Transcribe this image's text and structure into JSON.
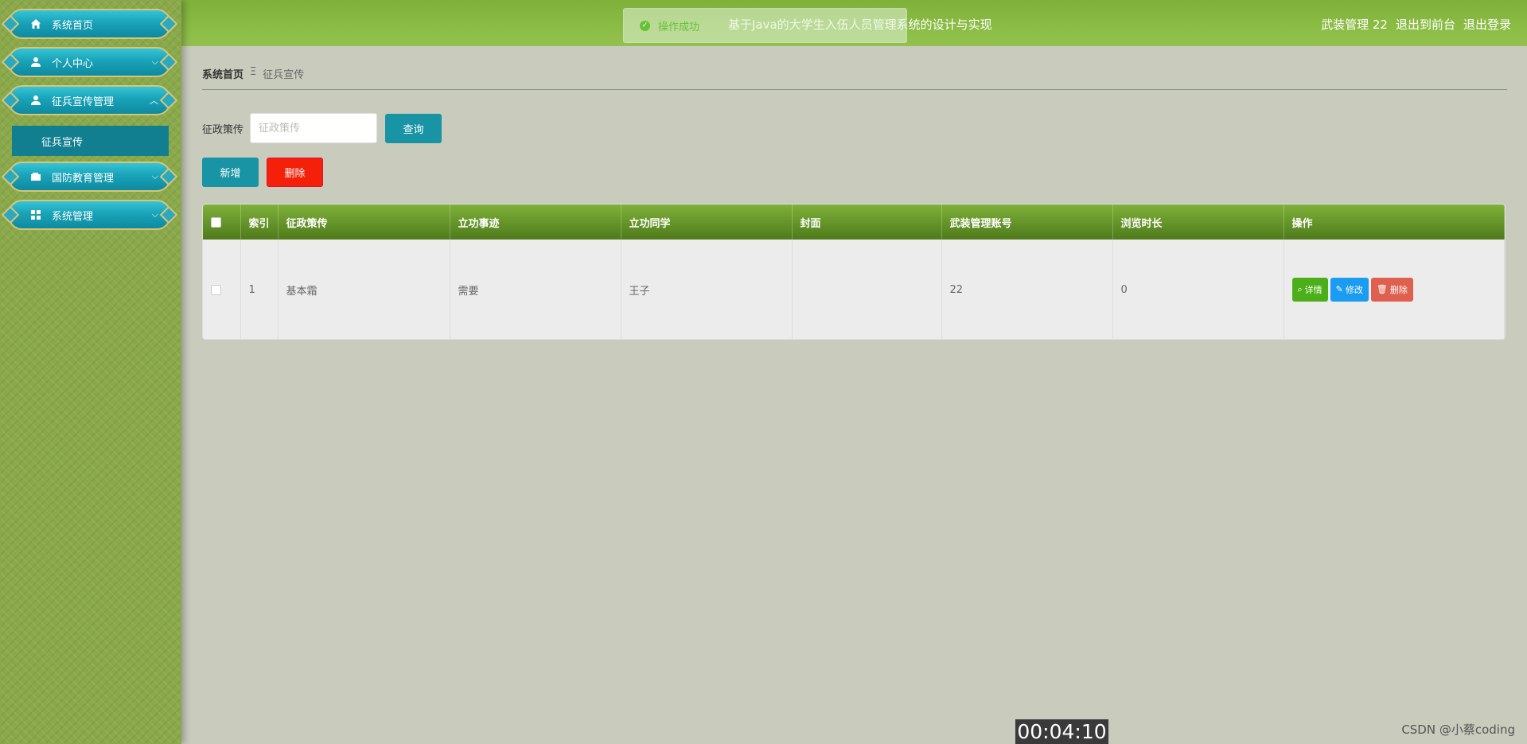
{
  "header": {
    "title": "基于Java的大学生入伍人员管理系统的设计与实现",
    "user": "武装管理 22",
    "to_front": "退出到前台",
    "logout": "退出登录"
  },
  "toast": {
    "message": "操作成功"
  },
  "sidebar": {
    "items": [
      {
        "label": "系统首页",
        "icon": "home-icon"
      },
      {
        "label": "个人中心",
        "icon": "user-icon",
        "arrow": "⌵"
      },
      {
        "label": "征兵宣传管理",
        "icon": "user-icon",
        "arrow": "︿"
      },
      {
        "label": "国防教育管理",
        "icon": "wallet-icon",
        "arrow": "⌵"
      },
      {
        "label": "系统管理",
        "icon": "grid-icon",
        "arrow": "⌵"
      }
    ],
    "active_sub": "征兵宣传"
  },
  "breadcrumb": {
    "home": "系统首页",
    "separator": "Ξ",
    "current": "征兵宣传"
  },
  "search": {
    "label": "征政策传",
    "placeholder": "征政策传",
    "button": "查询"
  },
  "actions": {
    "add": "新增",
    "delete": "删除"
  },
  "table": {
    "columns": [
      "索引",
      "征政策传",
      "立功事迹",
      "立功同学",
      "封面",
      "武装管理账号",
      "浏览时长",
      "操作"
    ],
    "rows": [
      {
        "index": "1",
        "policy": "基本霜",
        "deeds": "需要",
        "classmate": "王子",
        "cover": "",
        "account": "22",
        "duration": "0"
      }
    ],
    "ops": {
      "detail": "详情",
      "edit": "修改",
      "delete": "删除"
    }
  },
  "overlay": {
    "timer": "00:04:10",
    "watermark": "CSDN @小蔡coding"
  },
  "colors": {
    "header_green": "#8bbd45",
    "sidebar_teal": "#1aa3b8",
    "active_sub": "#127f90",
    "query_btn": "#1894a4",
    "delete_btn": "#f5200a",
    "detail_btn": "#4caf1a",
    "edit_btn": "#1a9cf0",
    "op_delete_btn": "#e06050"
  }
}
